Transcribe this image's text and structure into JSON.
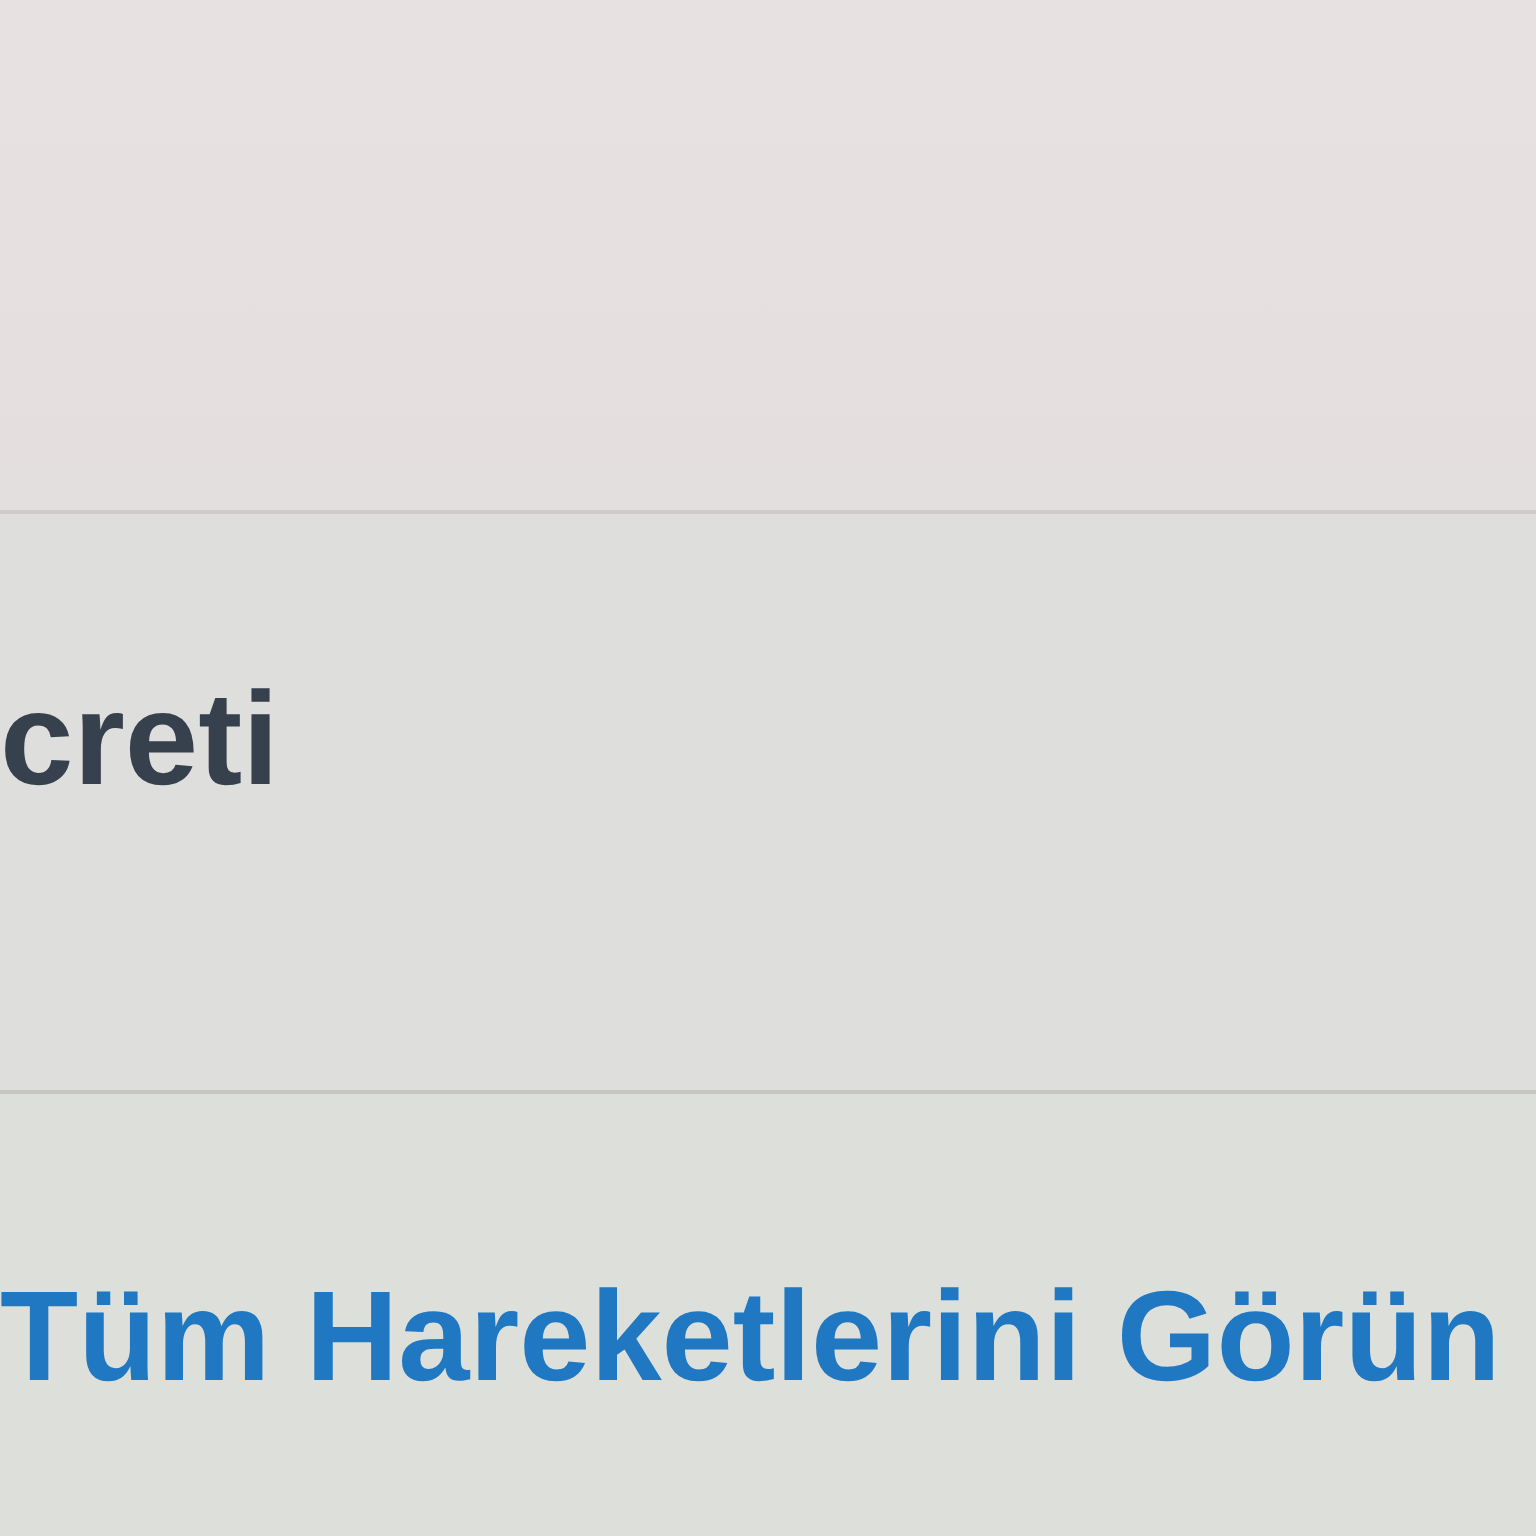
{
  "rows": [
    {
      "kind": "label",
      "text": "creti"
    },
    {
      "kind": "link",
      "text": "Tüm Hareketlerini Görün"
    }
  ]
}
